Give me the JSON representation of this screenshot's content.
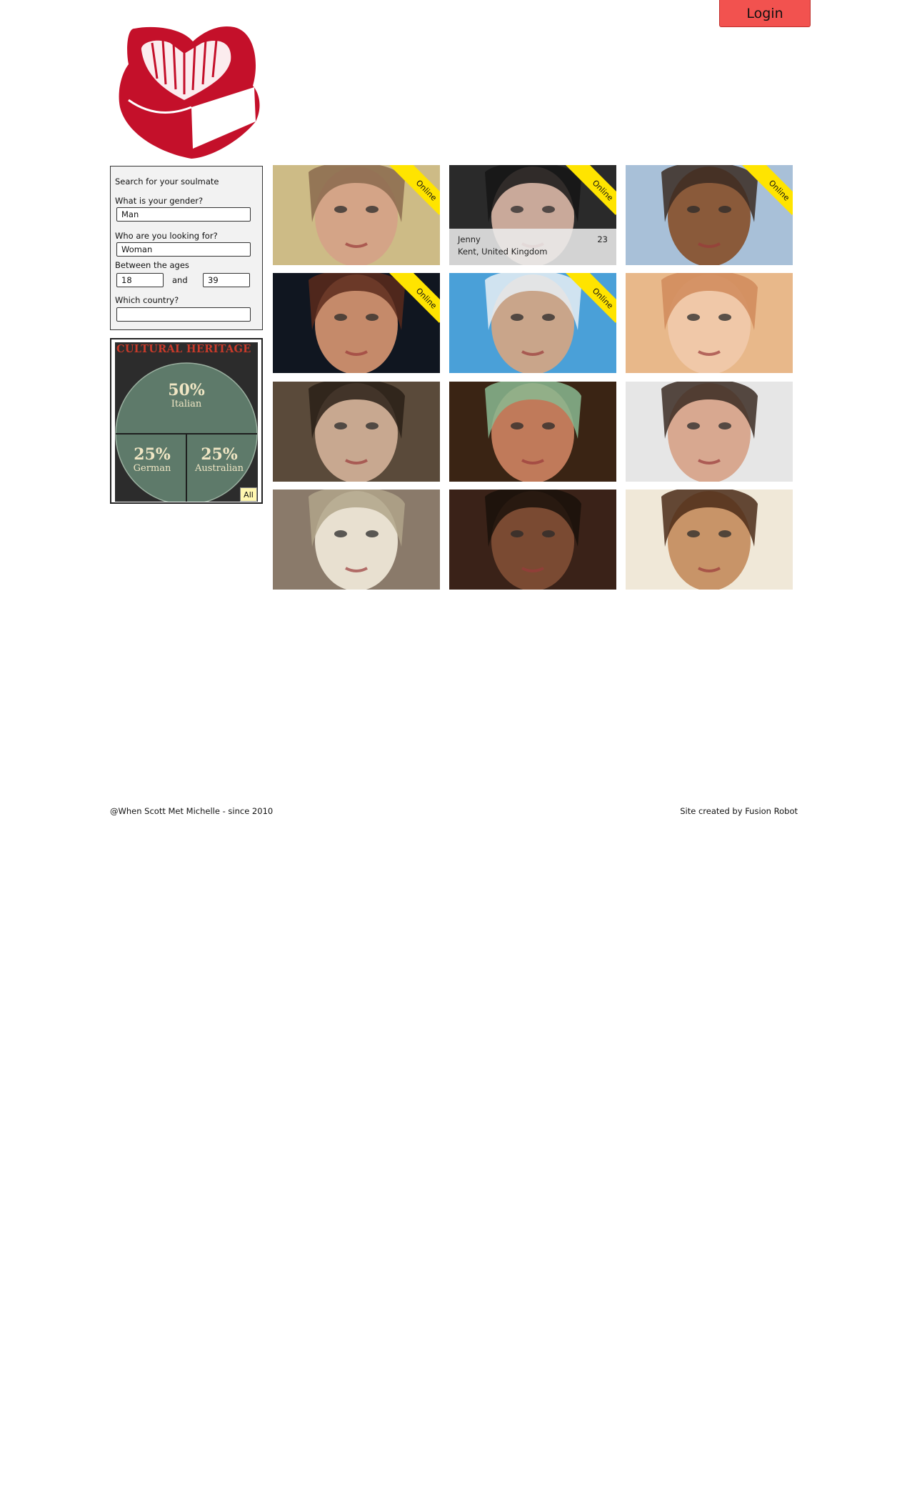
{
  "header": {
    "login_label": "Login"
  },
  "search": {
    "title": "Search for your soulmate",
    "gender_label": "What is your gender?",
    "gender_value": "Man",
    "looking_label": "Who are you looking for?",
    "looking_value": "Woman",
    "ages_label": "Between the ages",
    "age_min": "18",
    "and_label": "and",
    "age_max": "39",
    "country_label": "Which country?",
    "country_value": ""
  },
  "heritage": {
    "title": "CULTURAL HERITAGE",
    "slices": [
      {
        "percent": "50%",
        "name": "Italian"
      },
      {
        "percent": "25%",
        "name": "German"
      },
      {
        "percent": "25%",
        "name": "Australian"
      }
    ],
    "all_label": "All"
  },
  "profiles": [
    {
      "online": true,
      "online_label": "Online",
      "palette": [
        "#cdbb86",
        "#d4a487",
        "#8a6a4e"
      ]
    },
    {
      "online": true,
      "online_label": "Online",
      "palette": [
        "#2a2a2a",
        "#c9a99a",
        "#151515"
      ],
      "hover": true,
      "name": "Jenny",
      "age": "23",
      "location": "Kent, United Kingdom"
    },
    {
      "online": true,
      "online_label": "Online",
      "palette": [
        "#a8c0d8",
        "#8a5a3a",
        "#3a2a22"
      ]
    },
    {
      "online": true,
      "online_label": "Online",
      "palette": [
        "#101620",
        "#c58a6a",
        "#5a2a1c"
      ]
    },
    {
      "online": true,
      "online_label": "Online",
      "palette": [
        "#4aa0d8",
        "#c9a58a",
        "#e8eef4"
      ]
    },
    {
      "online": false,
      "palette": [
        "#e8b88a",
        "#f0c8a8",
        "#d08a5a"
      ]
    },
    {
      "online": false,
      "palette": [
        "#5a4a3a",
        "#c8a890",
        "#2a2018"
      ]
    },
    {
      "online": false,
      "palette": [
        "#3a2414",
        "#c07a5a",
        "#8ab890"
      ]
    },
    {
      "online": false,
      "palette": [
        "#e6e6e6",
        "#d8a890",
        "#3a2a22"
      ]
    },
    {
      "online": false,
      "palette": [
        "#8a7a6a",
        "#e8e0d0",
        "#b0a48a"
      ]
    },
    {
      "online": false,
      "palette": [
        "#3a2218",
        "#7a4a32",
        "#1a100a"
      ]
    },
    {
      "online": false,
      "palette": [
        "#f0e8d8",
        "#c89468",
        "#4a2a18"
      ]
    }
  ],
  "footer": {
    "left": "@When Scott Met Michelle - since 2010",
    "right": "Site created by Fusion Robot"
  }
}
